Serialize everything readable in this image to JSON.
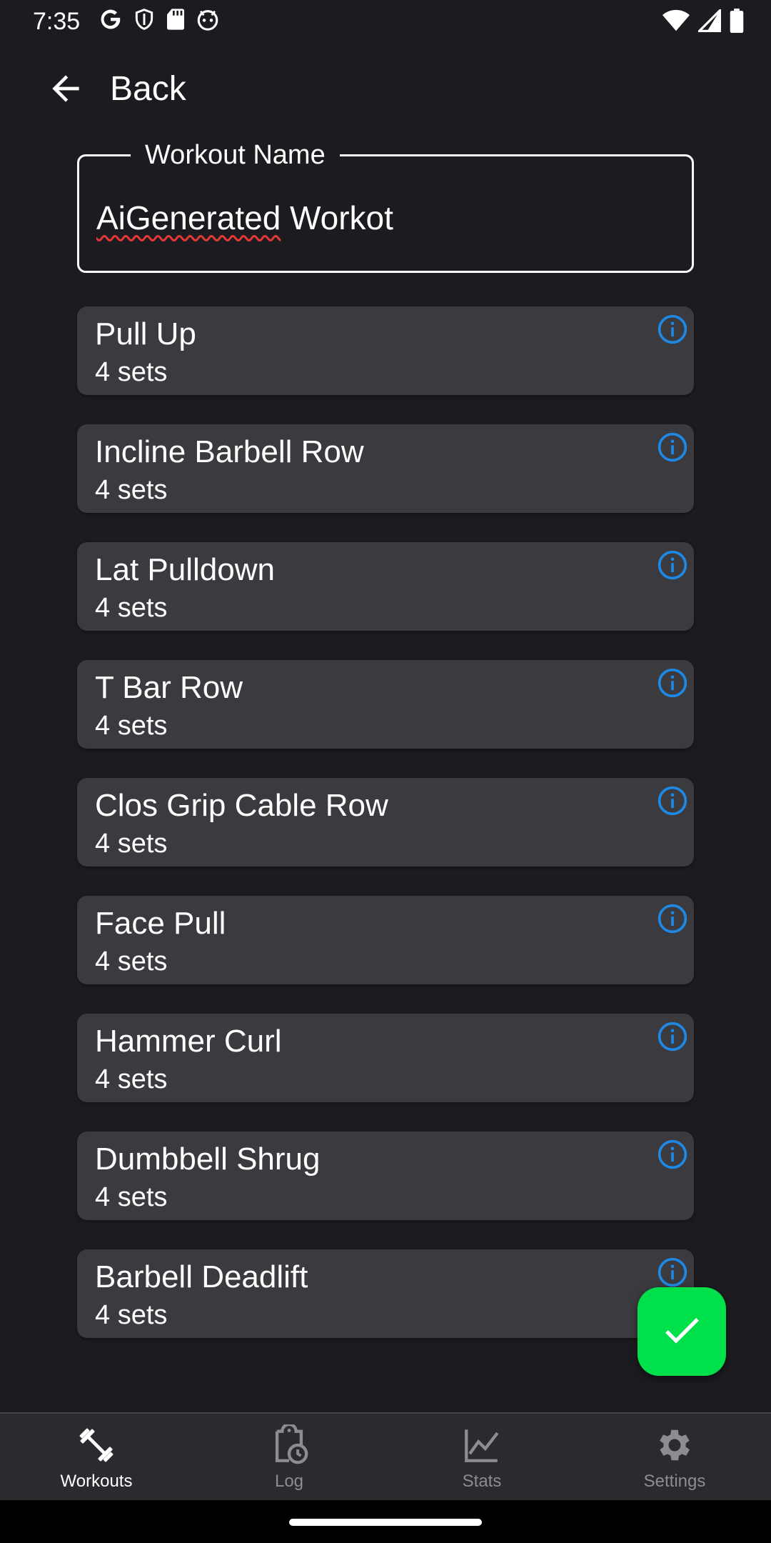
{
  "status_bar": {
    "time": "7:35",
    "left_icons": [
      "google-icon",
      "shield-icon",
      "sd-card-icon",
      "android-face-icon"
    ],
    "right_icons": [
      "wifi-icon",
      "cell-signal-icon",
      "battery-icon"
    ]
  },
  "header": {
    "back_label": "Back"
  },
  "name_field": {
    "label": "Workout Name",
    "value_misspelled": "AiGenerated",
    "value_rest": " Workot"
  },
  "exercises": [
    {
      "name": "Pull Up",
      "sets": "4 sets"
    },
    {
      "name": "Incline Barbell Row",
      "sets": "4 sets"
    },
    {
      "name": "Lat Pulldown",
      "sets": "4 sets"
    },
    {
      "name": "T Bar Row",
      "sets": "4 sets"
    },
    {
      "name": "Clos Grip Cable Row",
      "sets": "4 sets"
    },
    {
      "name": "Face Pull",
      "sets": "4 sets"
    },
    {
      "name": "Hammer Curl",
      "sets": "4 sets"
    },
    {
      "name": "Dumbbell Shrug",
      "sets": "4 sets"
    },
    {
      "name": "Barbell Deadlift",
      "sets": "4 sets"
    }
  ],
  "fab": {
    "icon": "checkmark-icon",
    "color": "#00e04a"
  },
  "bottom_nav": {
    "items": [
      {
        "label": "Workouts",
        "icon": "dumbbell-icon",
        "active": true
      },
      {
        "label": "Log",
        "icon": "clipboard-clock-icon",
        "active": false
      },
      {
        "label": "Stats",
        "icon": "chart-line-icon",
        "active": false
      },
      {
        "label": "Settings",
        "icon": "gear-icon",
        "active": false
      }
    ]
  },
  "colors": {
    "background": "#1c1b1f",
    "card": "#3b3a3f",
    "info_icon": "#1e88e5",
    "nav_active": "#ffffff",
    "nav_inactive": "#8d8c91",
    "spellcheck": "#e53935"
  }
}
